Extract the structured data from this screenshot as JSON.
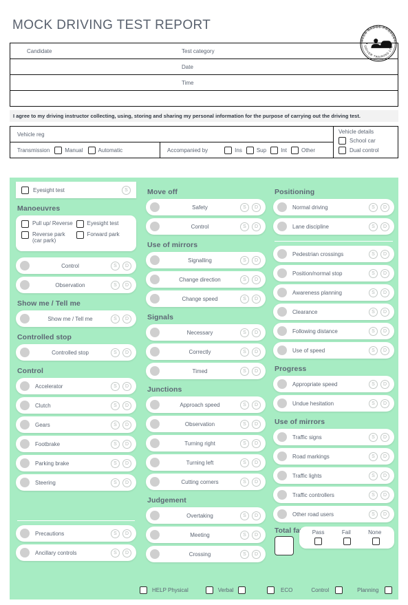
{
  "header": {
    "title": "MOCK DRIVING TEST REPORT",
    "logo": {
      "top_arc": "GREEN BADGE PRODUCTS",
      "bottom_arc": "DRIVER TRAINING LTD",
      "icon": "car-and-person-icon"
    }
  },
  "info_table": {
    "rows": [
      {
        "left": "Candidate",
        "right": "Test category"
      },
      {
        "left": "",
        "right": "Date"
      },
      {
        "left": "",
        "right": "Time"
      },
      {
        "left": "",
        "right": ""
      }
    ]
  },
  "consent": {
    "text": "I agree to my driving instructor collecting, using, storing and sharing my personal information for the purpose of carrying out the driving test."
  },
  "vehicle": {
    "reg_label": "Vehicle reg",
    "transmission_label": "Transmission",
    "transmission_options": [
      "Manual",
      "Automatic"
    ],
    "accompanied_label": "Accompanied by",
    "accompanied_options": [
      "Ins",
      "Sup",
      "Int",
      "Other"
    ],
    "details_title": "Vehicle details",
    "details_options": [
      "School car",
      "Dual control"
    ]
  },
  "colors": {
    "background_green": "#a7ecc3",
    "title_text": "#59616e",
    "pill_white": "#ffffff",
    "dot_grey": "#cfcfcf",
    "consent_strip": "#f2f2f2"
  },
  "marks": {
    "s": "S",
    "d": "D"
  },
  "column_left": {
    "eyesight_bar": {
      "label": "Eyesight test",
      "mark": "S"
    },
    "manoeuvres": {
      "title": "Manoeuvres",
      "options": [
        "Pull up/ Reverse",
        "Eyesight test",
        "Reverse park (car park)",
        "Forward park"
      ],
      "items": [
        "Control",
        "Observation"
      ]
    },
    "show_me": {
      "title": "Show me / Tell me",
      "items": [
        "Show me / Tell me"
      ]
    },
    "controlled_stop": {
      "title": "Controlled stop",
      "items": [
        "Controlled stop"
      ]
    },
    "control": {
      "title": "Control",
      "items": [
        "Accelerator",
        "Clutch",
        "Gears",
        "Footbrake",
        "Parking brake",
        "Steering"
      ]
    },
    "extra": {
      "items": [
        "Precautions",
        "Ancillary controls"
      ]
    }
  },
  "column_middle": {
    "move_off": {
      "title": "Move off",
      "items": [
        "Safety",
        "Control"
      ]
    },
    "use_of_mirrors": {
      "title": "Use of mirrors",
      "items": [
        "Signalling",
        "Change direction",
        "Change speed"
      ]
    },
    "signals": {
      "title": "Signals",
      "items": [
        "Necessary",
        "Correctly",
        "Timed"
      ]
    },
    "junctions": {
      "title": "Junctions",
      "items": [
        "Approach speed",
        "Observation",
        "Turning right",
        "Turning left",
        "Cutting corners"
      ]
    },
    "judgement": {
      "title": "Judgement",
      "items": [
        "Overtaking",
        "Meeting",
        "Crossing"
      ]
    }
  },
  "column_right": {
    "positioning": {
      "title": "Positioning",
      "items": [
        "Normal driving",
        "Lane discipline"
      ]
    },
    "positioning_extra": {
      "items": [
        "Pedestrian crossings",
        "Position/normal stop",
        "Awareness planning",
        "Clearance",
        "Following distance",
        "Use of speed"
      ]
    },
    "progress": {
      "title": "Progress",
      "items": [
        "Appropriate speed",
        "Undue hesitation"
      ]
    },
    "use_of_mirrors": {
      "title": "Use of mirrors",
      "items": [
        "Traffic signs",
        "Road markings",
        "Traffic lights",
        "Traffic controllers",
        "Other road users"
      ]
    },
    "total_faults": {
      "title": "Total faults",
      "value": "",
      "outcomes": [
        "Pass",
        "Fail",
        "None"
      ]
    }
  },
  "footer": {
    "help_label": "HELP Physical",
    "verbal_label": "Verbal",
    "eco_label": "ECO",
    "control_label": "Control",
    "planning_label": "Planning"
  }
}
